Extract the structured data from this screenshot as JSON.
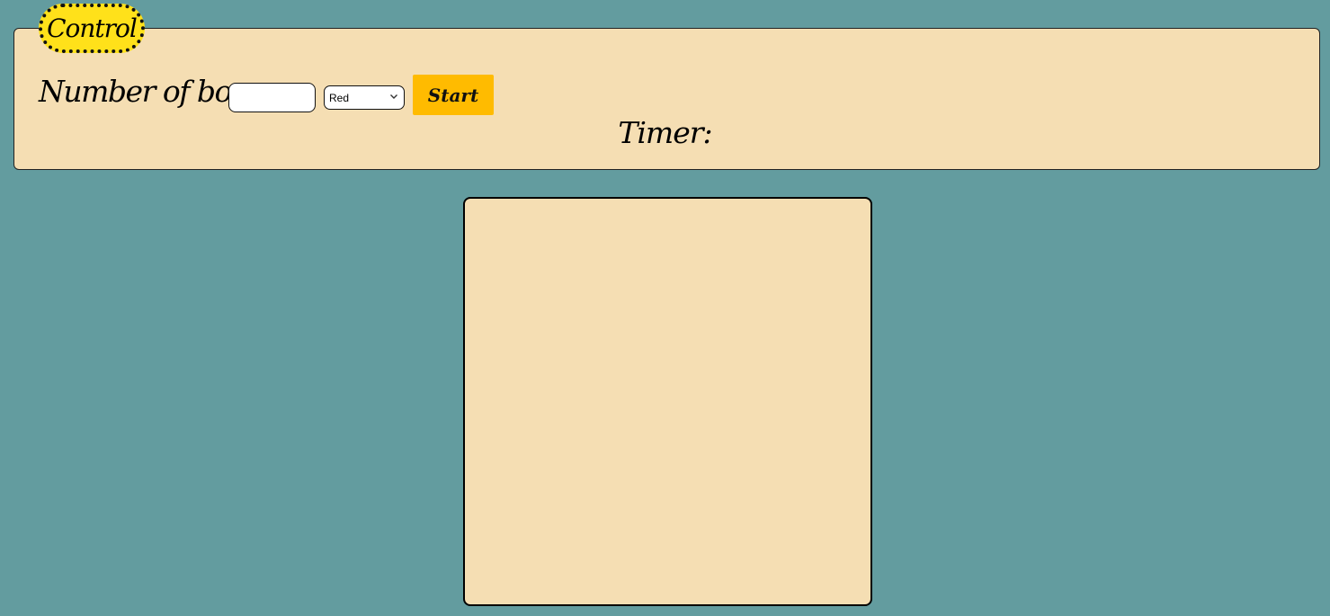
{
  "control": {
    "legend": "Control",
    "number_label": "Number of  box:",
    "box_input": {
      "value": "",
      "placeholder": ""
    },
    "color_select": {
      "selected": "Red"
    },
    "start_label": "Start",
    "timer_label": "Timer:"
  },
  "colors": {
    "background": "#639c9f",
    "panel": "#f5deb3",
    "legend_fill": "#ffe11a",
    "start_button": "#ffbb00"
  }
}
